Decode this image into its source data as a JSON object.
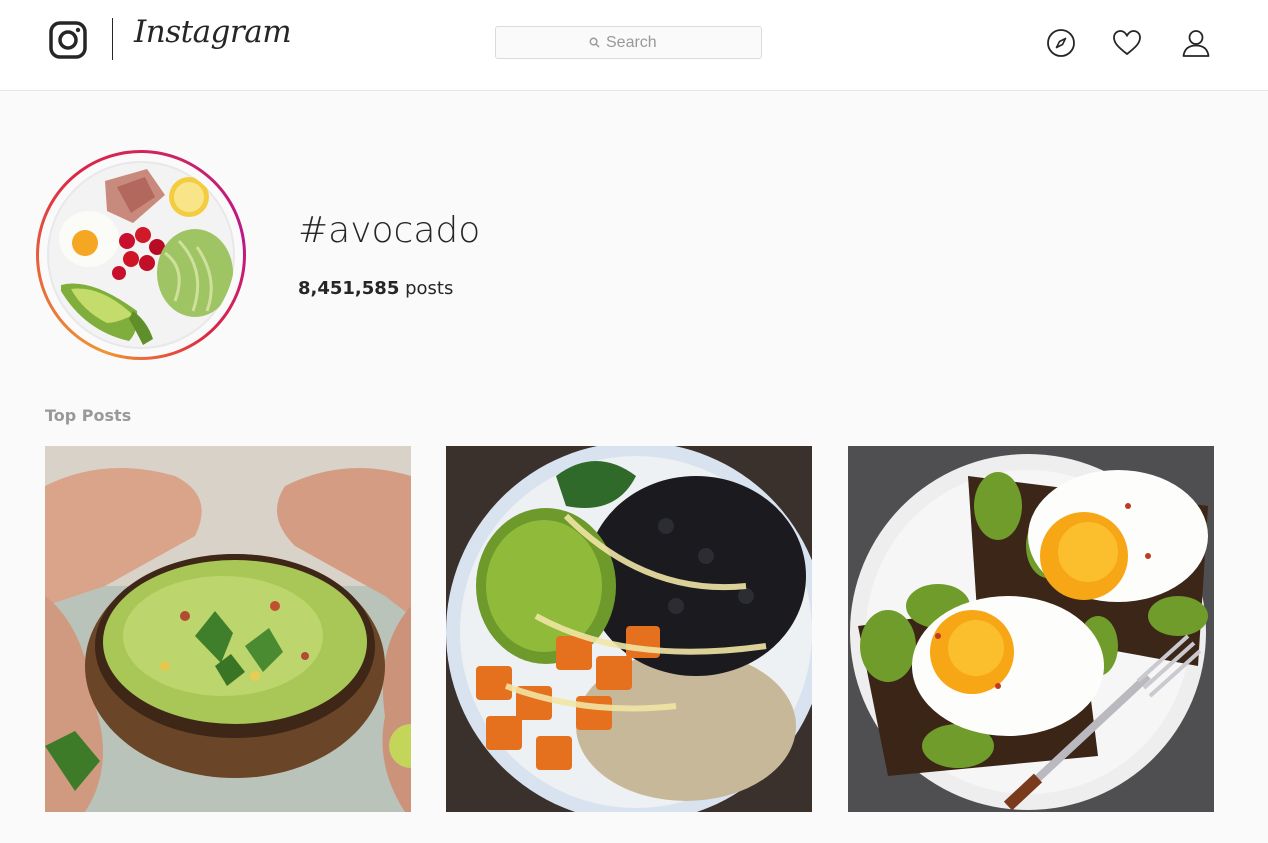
{
  "header": {
    "wordmark": "Instagram",
    "search": {
      "placeholder": "Search",
      "value": ""
    },
    "nav": [
      {
        "name": "explore",
        "icon": "compass-icon"
      },
      {
        "name": "activity",
        "icon": "heart-icon"
      },
      {
        "name": "profile",
        "icon": "user-icon"
      }
    ]
  },
  "hashtag": {
    "title": "#avocado",
    "post_count": "8,451,585",
    "post_count_label": "posts",
    "avatar_icon": "hashtag-cover-image"
  },
  "top_posts": {
    "label": "Top Posts",
    "posts": [
      {
        "icon": "guacamole-bowl-image"
      },
      {
        "icon": "avocado-bean-bowl-image"
      },
      {
        "icon": "avocado-toast-eggs-image"
      }
    ]
  },
  "colors": {
    "accent_gradient": [
      "#f09433",
      "#dc2743",
      "#bc1888"
    ],
    "text": "#262626",
    "muted": "#999999",
    "border": "#dbdbdb"
  }
}
